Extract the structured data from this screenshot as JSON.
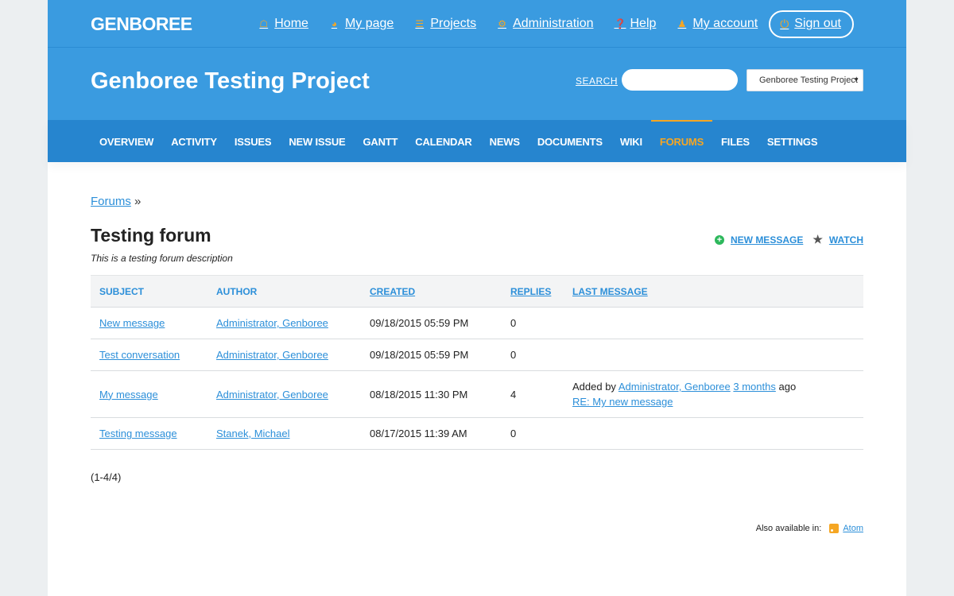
{
  "app": {
    "logo": "GENBOREE"
  },
  "topnav": {
    "items": [
      {
        "label": "Home",
        "icon": "home-icon"
      },
      {
        "label": "My page",
        "icon": "dashboard-icon"
      },
      {
        "label": "Projects",
        "icon": "list-icon"
      },
      {
        "label": "Administration",
        "icon": "gear-icon"
      },
      {
        "label": "Help",
        "icon": "help-icon"
      },
      {
        "label": "My account",
        "icon": "user-icon"
      }
    ],
    "signout": {
      "label": "Sign out",
      "icon": "power-icon"
    }
  },
  "project": {
    "title": "Genboree Testing Project",
    "search_label": "SEARCH",
    "search_value": "",
    "select_value": "Genboree Testing Project"
  },
  "menu": {
    "items": [
      "OVERVIEW",
      "ACTIVITY",
      "ISSUES",
      "NEW ISSUE",
      "GANTT",
      "CALENDAR",
      "NEWS",
      "DOCUMENTS",
      "WIKI",
      "FORUMS",
      "FILES",
      "SETTINGS"
    ],
    "active": "FORUMS"
  },
  "breadcrumb": {
    "link": "Forums",
    "sep": "»"
  },
  "forum": {
    "title": "Testing forum",
    "description": "This is a testing forum description",
    "new_message_label": "NEW MESSAGE",
    "watch_label": "WATCH"
  },
  "table": {
    "headers": {
      "subject": "SUBJECT",
      "author": "AUTHOR",
      "created": "CREATED",
      "replies": "REPLIES",
      "last_message": "LAST MESSAGE"
    },
    "rows": [
      {
        "subject": "New message",
        "author": "Administrator, Genboree",
        "created": "09/18/2015 05:59 PM",
        "replies": "0"
      },
      {
        "subject": "Test conversation",
        "author": "Administrator, Genboree",
        "created": "09/18/2015 05:59 PM",
        "replies": "0"
      },
      {
        "subject": "My message",
        "author": "Administrator, Genboree",
        "created": "08/18/2015 11:30 PM",
        "replies": "4",
        "last": {
          "prefix": "Added by",
          "author": "Administrator, Genboree",
          "when": "3 months",
          "suffix": "ago",
          "link": "RE: My new message"
        }
      },
      {
        "subject": "Testing message",
        "author": "Stanek, Michael",
        "created": "08/17/2015 11:39 AM",
        "replies": "0"
      }
    ]
  },
  "pagination": "(1-4/4)",
  "other_formats": {
    "label": "Also available in:",
    "atom": "Atom"
  },
  "colors": {
    "primary": "#3a9be0",
    "menu": "#2685cf",
    "accent": "#f5a623",
    "link": "#2c8fd9"
  }
}
